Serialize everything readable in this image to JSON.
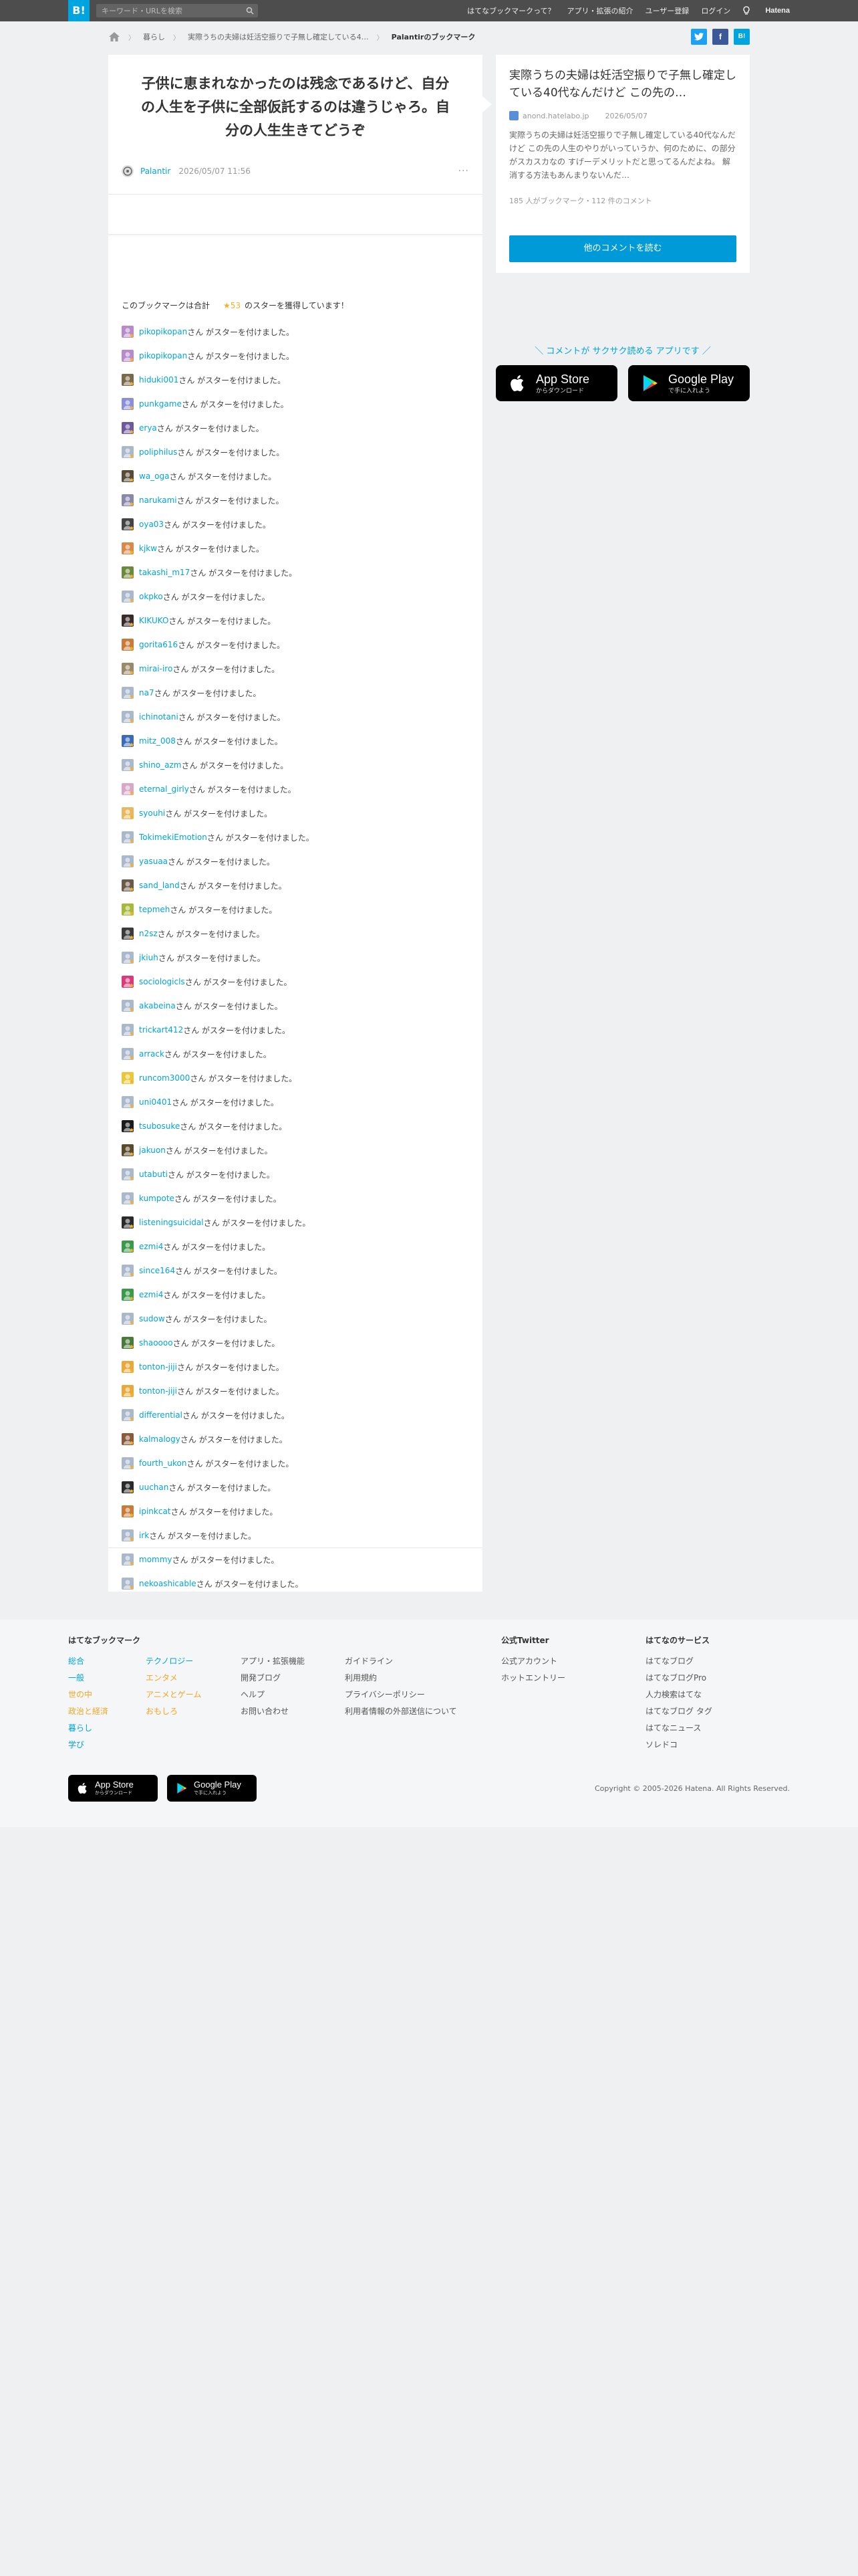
{
  "topbar": {
    "logo": "B!",
    "search_placeholder": "キーワード・URLを検索",
    "nav": [
      "はてなブックマークって？",
      "アプリ・拡張の紹介",
      "ユーザー登録",
      "ログイン"
    ],
    "brand": "Hatena"
  },
  "breadcrumb": {
    "items": [
      "暮らし",
      "実際うちの夫婦は妊活空振りで子無し確定している4…"
    ],
    "current": "Palantirのブックマーク",
    "share": [
      "twitter",
      "facebook",
      "hatena"
    ]
  },
  "comment": {
    "text": "子供に恵まれなかったのは残念であるけど、自分の人生を子供に全部仮託するのは違うじゃろ。自分の人生生きてどうぞ",
    "user": "Palantir",
    "date": "2026/05/07 11:56",
    "more": "···"
  },
  "star_summary": {
    "prefix": "このブックマークは合計",
    "count": "★53",
    "suffix": "のスターを獲得しています！",
    "suffix_text": "さん がスターを付けました。"
  },
  "stars": [
    {
      "user": "pikopikopan",
      "color": "#b98ac9"
    },
    {
      "user": "pikopikopan",
      "color": "#b98ac9"
    },
    {
      "user": "hiduki001",
      "color": "#7a6a4a"
    },
    {
      "user": "punkgame",
      "color": "#8b8fd8"
    },
    {
      "user": "erya",
      "color": "#6c5a9c"
    },
    {
      "user": "poliphilus",
      "color": "#aab8cc"
    },
    {
      "user": "wa_oga",
      "color": "#5a4a3a"
    },
    {
      "user": "narukami",
      "color": "#8888aa"
    },
    {
      "user": "oya03",
      "color": "#444444"
    },
    {
      "user": "kjkw",
      "color": "#d88a4a"
    },
    {
      "user": "takashi_m17",
      "color": "#6a8a3a"
    },
    {
      "user": "okpko",
      "color": "#aab8cc"
    },
    {
      "user": "KIKUKO",
      "color": "#3a2a2a"
    },
    {
      "user": "gorita616",
      "color": "#c87a3a"
    },
    {
      "user": "mirai-iro",
      "color": "#9a8a6a"
    },
    {
      "user": "na7",
      "color": "#aab8cc"
    },
    {
      "user": "ichinotani",
      "color": "#aab8cc"
    },
    {
      "user": "mitz_008",
      "color": "#3a6ab8"
    },
    {
      "user": "shino_azm",
      "color": "#aab8cc"
    },
    {
      "user": "eternal_girly",
      "color": "#d8a8c8"
    },
    {
      "user": "syouhi",
      "color": "#e8b860"
    },
    {
      "user": "TokimekiEmotion",
      "color": "#aab8cc"
    },
    {
      "user": "yasuaa",
      "color": "#aab8cc"
    },
    {
      "user": "sand_land",
      "color": "#6a5a4a"
    },
    {
      "user": "tepmeh",
      "color": "#a8b83a"
    },
    {
      "user": "n2sz",
      "color": "#3a3a3a"
    },
    {
      "user": "jkiuh",
      "color": "#aab8cc"
    },
    {
      "user": "sociologicls",
      "color": "#d83a7a"
    },
    {
      "user": "akabeina",
      "color": "#aab8cc"
    },
    {
      "user": "trickart412",
      "color": "#aab8cc"
    },
    {
      "user": "arrack",
      "color": "#aab8cc"
    },
    {
      "user": "runcom3000",
      "color": "#e8c83a"
    },
    {
      "user": "uni0401",
      "color": "#aab8cc"
    },
    {
      "user": "tsubosuke",
      "color": "#1a1a1a"
    },
    {
      "user": "jakuon",
      "color": "#5a4a2a"
    },
    {
      "user": "utabuti",
      "color": "#aab8cc"
    },
    {
      "user": "kumpote",
      "color": "#aab8cc"
    },
    {
      "user": "listeningsuicidal",
      "color": "#2a2a2a"
    },
    {
      "user": "ezmi4",
      "color": "#3a9a4a"
    },
    {
      "user": "since164",
      "color": "#aab8cc"
    },
    {
      "user": "ezmi4",
      "color": "#3a9a4a"
    },
    {
      "user": "sudow",
      "color": "#aab8cc"
    },
    {
      "user": "shaoooo",
      "color": "#4a7a3a"
    },
    {
      "user": "tonton-jiji",
      "color": "#e8a83a"
    },
    {
      "user": "tonton-jiji",
      "color": "#e8a83a"
    },
    {
      "user": "differential",
      "color": "#aab8cc"
    },
    {
      "user": "kalmalogy",
      "color": "#8a5a3a"
    },
    {
      "user": "fourth_ukon",
      "color": "#aab8cc"
    },
    {
      "user": "uuchan",
      "color": "#2a2a2a"
    },
    {
      "user": "ipinkcat",
      "color": "#c87a3a"
    },
    {
      "user": "irk",
      "color": "#aab8cc"
    },
    {
      "user": "mommy",
      "color": "#aab8cc"
    },
    {
      "user": "nekoashicable",
      "color": "#aab8cc"
    }
  ],
  "entry": {
    "title": "実際うちの夫婦は妊活空振りで子無し確定している40代なんだけど この先の…",
    "domain": "anond.hatelabo.jp",
    "date": "2026/05/07",
    "description": "実際うちの夫婦は妊活空振りで子無し確定している40代なんだけど この先の人生のやりがいっていうか、何のために、の部分がスカスカなの すげーデメリットだと思ってるんだよね。 解消する方法もあんまりないんだ…",
    "counts": "185 人がブックマーク・112 件のコメント",
    "button": "他のコメントを読む"
  },
  "promo": {
    "text": "＼ コメントが サクサク読める アプリです ／",
    "appstore_big": "App Store",
    "appstore_small": "からダウンロード",
    "googleplay_big": "Google Play",
    "googleplay_small": "で手に入れよう"
  },
  "footer": {
    "col1_head": "はてなブックマーク",
    "cats_a": [
      "総合",
      "一般",
      "世の中",
      "政治と経済",
      "暮らし",
      "学び"
    ],
    "cats_b": [
      "テクノロジー",
      "エンタメ",
      "アニメとゲーム",
      "おもしろ"
    ],
    "links_c": [
      "アプリ・拡張機能",
      "開発ブログ",
      "ヘルプ",
      "お問い合わせ"
    ],
    "links_d": [
      "ガイドライン",
      "利用規約",
      "プライバシーポリシー",
      "利用者情報の外部送信について"
    ],
    "twitter_head": "公式Twitter",
    "twitter_links": [
      "公式アカウント",
      "ホットエントリー"
    ],
    "services_head": "はてなのサービス",
    "services": [
      "はてなブログ",
      "はてなブログPro",
      "人力検索はてな",
      "はてなブログ タグ",
      "はてなニュース",
      "ソレドコ"
    ],
    "copyright": "Copyright © 2005-2026 Hatena. All Rights Reserved."
  }
}
